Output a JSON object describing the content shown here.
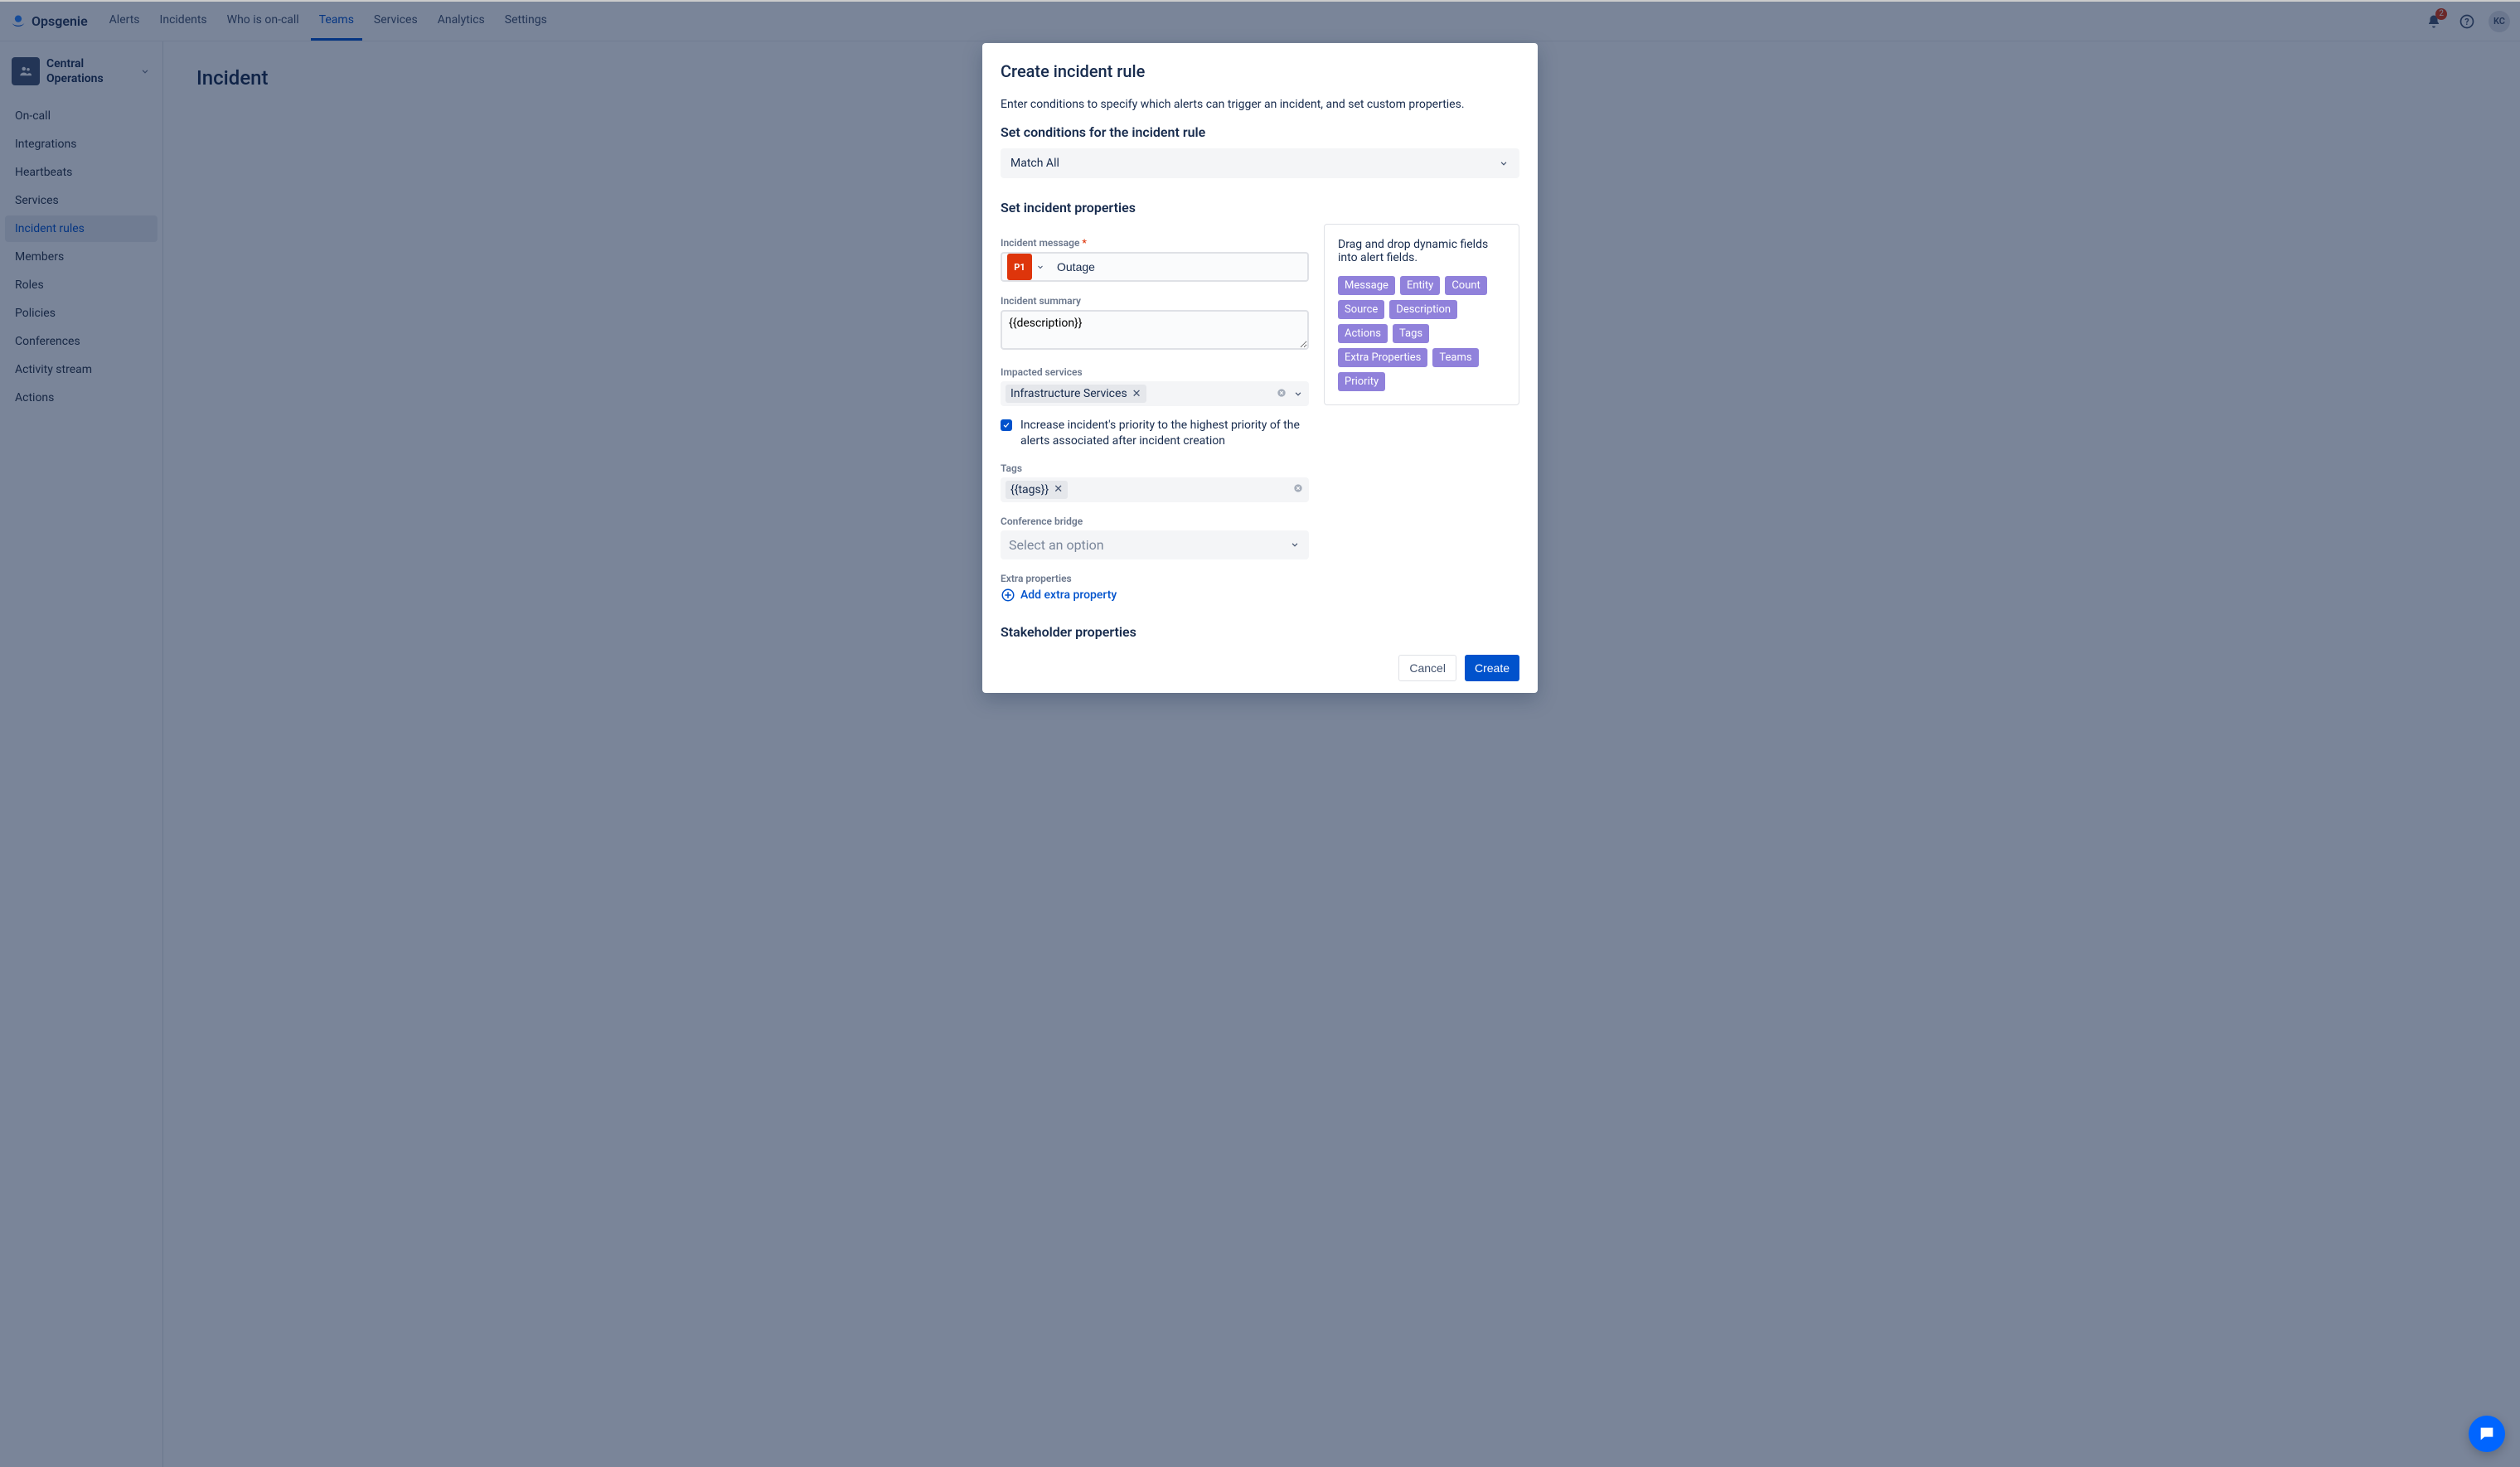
{
  "brand": "Opsgenie",
  "nav": [
    "Alerts",
    "Incidents",
    "Who is on-call",
    "Teams",
    "Services",
    "Analytics",
    "Settings"
  ],
  "nav_active": 3,
  "notif_count": "2",
  "avatar": "KC",
  "team": {
    "name": "Central Operations"
  },
  "sidebar": [
    "On-call",
    "Integrations",
    "Heartbeats",
    "Services",
    "Incident rules",
    "Members",
    "Roles",
    "Policies",
    "Conferences",
    "Activity stream",
    "Actions"
  ],
  "sidebar_active": 4,
  "page_title": "Incident",
  "modal": {
    "title": "Create incident rule",
    "subtitle": "Enter conditions to specify which alerts can trigger an incident, and set custom properties.",
    "conditions_header": "Set conditions for the incident rule",
    "match": "Match All",
    "properties_header": "Set incident properties",
    "labels": {
      "message": "Incident message",
      "summary": "Incident summary",
      "impacted": "Impacted services",
      "tags": "Tags",
      "conference": "Conference bridge",
      "extra": "Extra properties",
      "stakeholder": "Stakeholder properties"
    },
    "priority": "P1",
    "message_value": "Outage",
    "summary_value": "{{description}}",
    "impacted_value": "Infrastructure Services",
    "increase_label": "Increase incident's priority to the highest priority of the alerts associated after incident creation",
    "tags_value": "{{tags}}",
    "conference_placeholder": "Select an option",
    "add_extra": "Add extra property",
    "side_help": "Drag and drop dynamic fields into alert fields.",
    "chips": [
      "Message",
      "Entity",
      "Count",
      "Source",
      "Description",
      "Actions",
      "Tags",
      "Extra Properties",
      "Teams",
      "Priority"
    ],
    "cancel": "Cancel",
    "create": "Create"
  }
}
